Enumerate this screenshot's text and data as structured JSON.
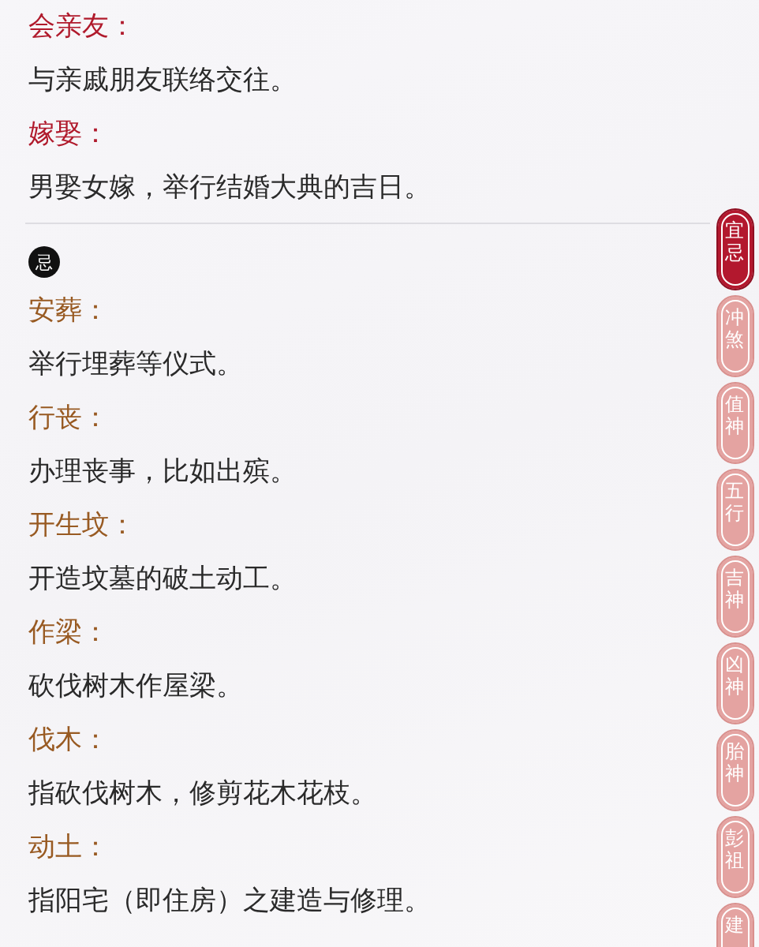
{
  "sections": [
    {
      "kind": "good",
      "items": [
        {
          "term": "会亲友：",
          "description": "与亲戚朋友联络交往。"
        },
        {
          "term": "嫁娶：",
          "description": "男娶女嫁，举行结婚大典的吉日。"
        }
      ]
    },
    {
      "kind": "bad",
      "badge": "忌",
      "items": [
        {
          "term": "安葬：",
          "description": "举行埋葬等仪式。"
        },
        {
          "term": "行丧：",
          "description": "办理丧事，比如出殡。"
        },
        {
          "term": "开生坟：",
          "description": "开造坟墓的破土动工。"
        },
        {
          "term": "作梁：",
          "description": "砍伐树木作屋梁。"
        },
        {
          "term": "伐木：",
          "description": "指砍伐树木，修剪花木花枝。"
        },
        {
          "term": "动土：",
          "description": "指阳宅（即住房）之建造与修理。"
        }
      ]
    }
  ],
  "side_tabs": [
    {
      "label": "宜忌",
      "selected": true
    },
    {
      "label": "冲煞",
      "selected": false
    },
    {
      "label": "值神",
      "selected": false
    },
    {
      "label": "五行",
      "selected": false
    },
    {
      "label": "吉神",
      "selected": false
    },
    {
      "label": "凶神",
      "selected": false
    },
    {
      "label": "胎神",
      "selected": false
    },
    {
      "label": "彭祖",
      "selected": false
    },
    {
      "label": "建",
      "selected": false
    }
  ]
}
